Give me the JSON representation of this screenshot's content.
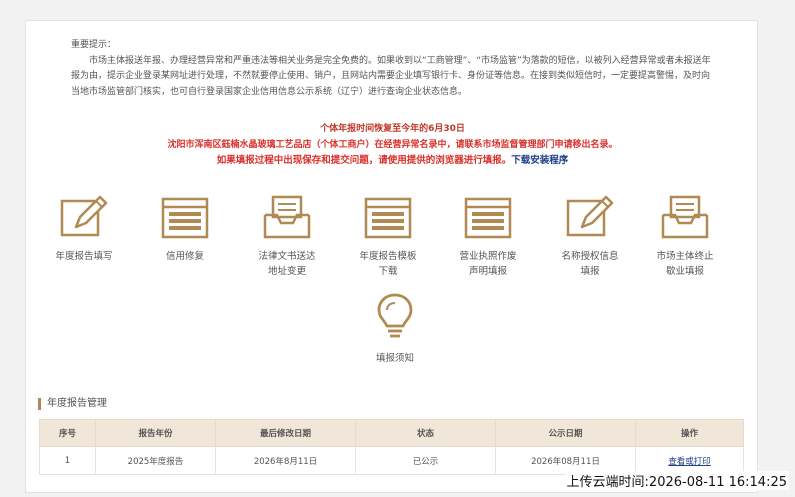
{
  "notice": {
    "title": "重要提示：",
    "paragraph": "市场主体报送年报、办理经营异常和严重违法等相关业务是完全免费的。如果收到以“工商管理”、“市场监管”为落款的短信，以被列入经营异常或者未报送年报为由，提示企业登录某网址进行处理，不然就要停止使用、销户，且网站内需要企业填写银行卡、身份证等信息。在接到类似短信时，一定要提高警惕，及时向当地市场监管部门核实，也可自行登录国家企业信用信息公示系统（辽宁）进行查询企业状态信息。"
  },
  "alerts": {
    "line1": "个体年报时间恢复至今年的6月30日",
    "line2": "沈阳市浑南区鈺楠水晶玻璃工艺品店（个体工商户）在经营异常名录中，请联系市场监督管理部门申请移出名录。",
    "line3": "如果填报过程中出现保存和提交问题，请使用提供的浏览器进行填报。",
    "link": "下载安装程序"
  },
  "tiles": [
    {
      "label": "年度报告填写",
      "icon": "edit-icon"
    },
    {
      "label": "信用修复",
      "icon": "form-icon"
    },
    {
      "label": "法律文书送达地址变更",
      "icon": "inbox-icon"
    },
    {
      "label": "年度报告模板下载",
      "icon": "form-icon"
    },
    {
      "label": "营业执照作废声明填报",
      "icon": "form-icon"
    },
    {
      "label": "名称授权信息填报",
      "icon": "edit-icon"
    },
    {
      "label": "市场主体终止歇业填报",
      "icon": "inbox-icon"
    },
    {
      "label": "填报须知",
      "icon": "lightbulb-icon"
    }
  ],
  "section": {
    "title": "年度报告管理"
  },
  "table": {
    "headers": [
      "序号",
      "报告年份",
      "最后修改日期",
      "状态",
      "公示日期",
      "操作"
    ],
    "rows": [
      [
        "1",
        "2025年度报告",
        "2026年8月11日",
        "已公示",
        "2026年08月11日",
        "查看或打印"
      ]
    ]
  },
  "watermark": "上传云端时间:2026-08-11 16:14:25",
  "colors": {
    "accent": "#b08a52",
    "alert": "#d9312c",
    "link": "#1e3f8c",
    "header_bg": "#f1e7d8"
  }
}
